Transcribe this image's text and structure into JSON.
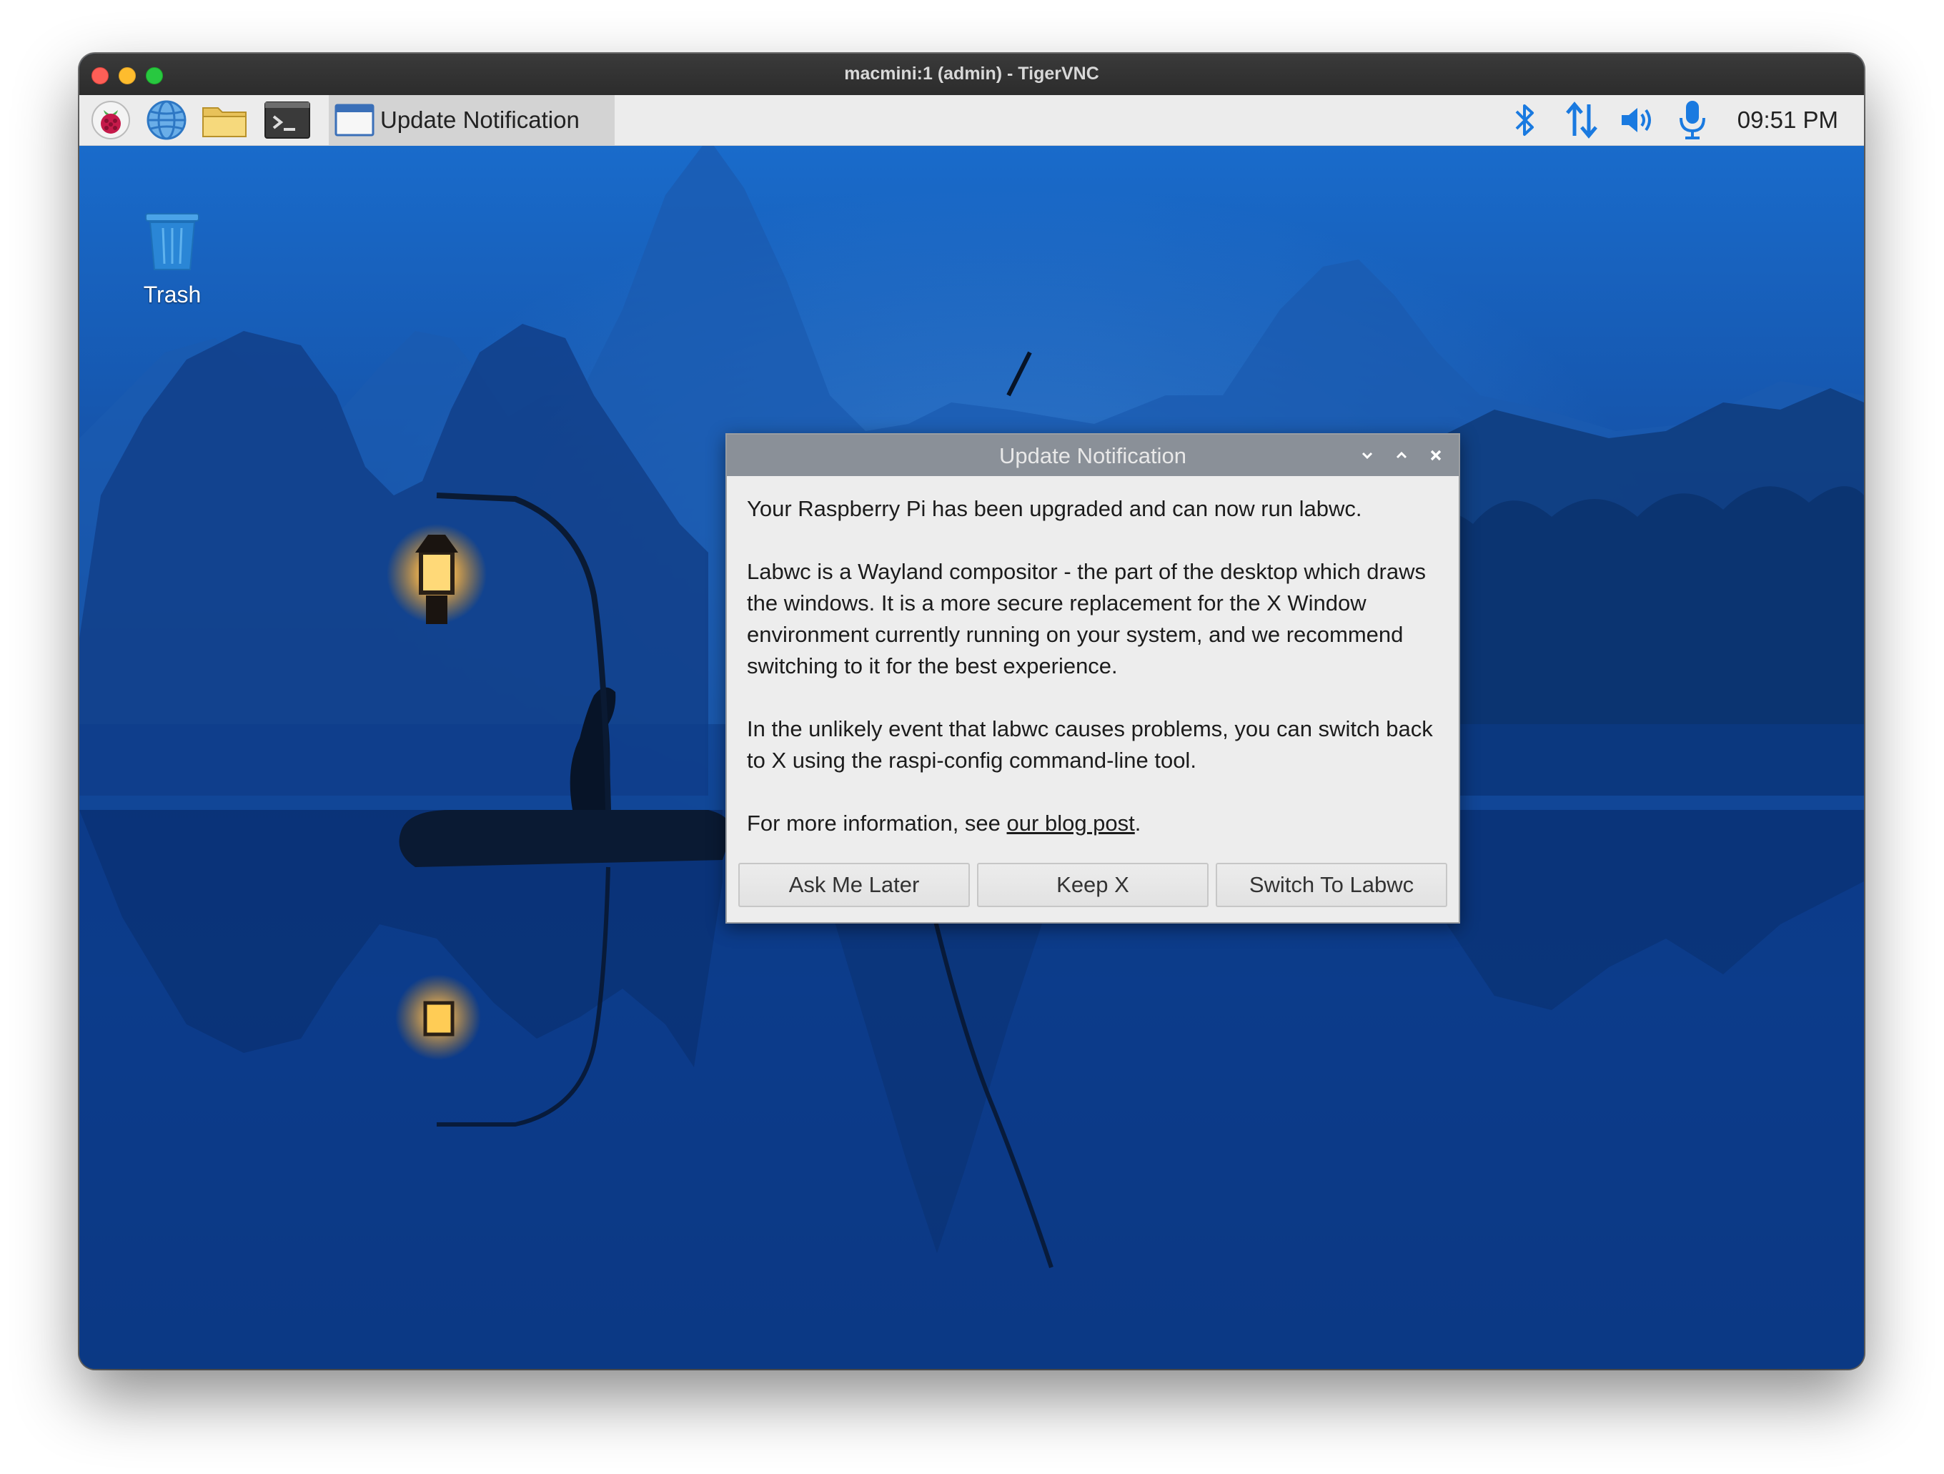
{
  "window": {
    "title": "macmini:1 (admin) - TigerVNC"
  },
  "taskbar": {
    "launchers": [
      {
        "icon": "raspberry-pi-menu-icon"
      },
      {
        "icon": "web-browser-icon"
      },
      {
        "icon": "file-manager-icon"
      },
      {
        "icon": "terminal-icon"
      }
    ],
    "active_task_label": "Update Notification",
    "tray": {
      "bluetooth_icon": "bluetooth-icon",
      "network_icon": "network-icon",
      "volume_icon": "volume-icon",
      "microphone_icon": "microphone-icon"
    },
    "clock": "09:51 PM"
  },
  "desktop": {
    "trash_label": "Trash"
  },
  "dialog": {
    "title": "Update Notification",
    "paragraph1": "Your Raspberry Pi has been upgraded and can now run labwc.",
    "paragraph2": "Labwc is a Wayland compositor - the part of the desktop which draws the windows. It is a more secure replacement for the X Window environment currently running on your system, and we recommend switching to it for the best experience.",
    "paragraph3": "In the unlikely event that labwc causes problems, you can switch back to X using the raspi-config command-line tool.",
    "paragraph4_prefix": "For more information, see ",
    "paragraph4_link": "our blog post",
    "paragraph4_suffix": ".",
    "buttons": {
      "ask_later": "Ask Me Later",
      "keep_x": "Keep X",
      "switch": "Switch To Labwc"
    }
  },
  "colors": {
    "tray_accent": "#1a7ae0",
    "dialog_titlebar": "#8a9098",
    "taskbar_bg": "#ececec"
  }
}
